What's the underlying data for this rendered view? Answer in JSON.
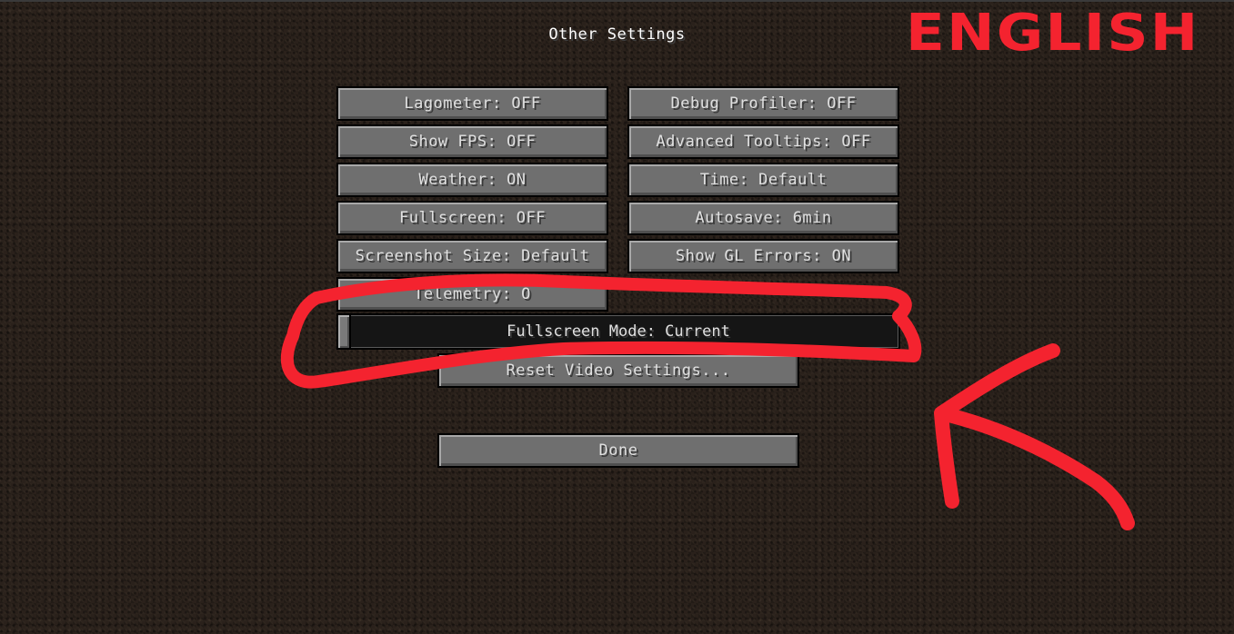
{
  "screen": {
    "title": "Other Settings"
  },
  "overlay": {
    "label": "ENGLISH",
    "color": "#f4232f"
  },
  "buttons": {
    "lagometer": "Lagometer: OFF",
    "debug_profiler": "Debug Profiler: OFF",
    "show_fps": "Show FPS: OFF",
    "advanced_tooltips": "Advanced Tooltips: OFF",
    "weather": "Weather: ON",
    "time": "Time: Default",
    "fullscreen": "Fullscreen: OFF",
    "autosave": "Autosave: 6min",
    "screenshot_size": "Screenshot Size: Default",
    "show_gl_errors": "Show GL Errors: ON",
    "telemetry": "Telemetry: O",
    "fullscreen_mode": "Fullscreen Mode: Current",
    "reset_video": "Reset Video Settings...",
    "done": "Done"
  }
}
